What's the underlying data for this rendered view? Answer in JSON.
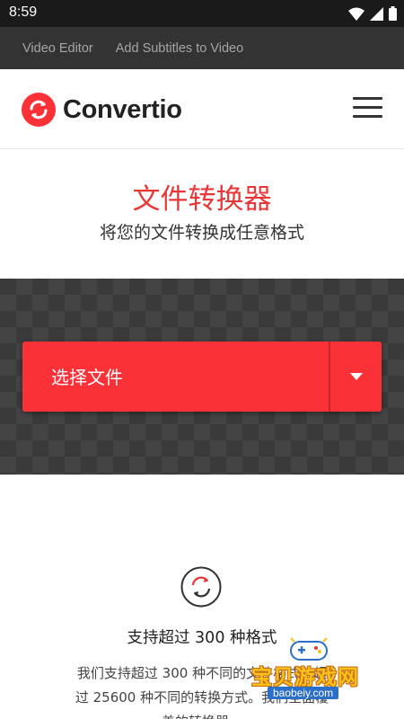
{
  "status_bar": {
    "time": "8:59"
  },
  "topnav": {
    "links": [
      "Video Editor",
      "Add Subtitles to Video"
    ]
  },
  "header": {
    "logo_text": "Convertio"
  },
  "hero": {
    "title": "文件转换器",
    "subtitle": "将您的文件转换成任意格式"
  },
  "upload": {
    "choose_label": "选择文件"
  },
  "features": {
    "title": "支持超过 300 种格式",
    "desc_line1": "我们支持超过 300 种不同的文件格式，超",
    "desc_line2": "过 25600 种不同的转换方式。我们全面覆",
    "desc_line3": "盖的转换器。"
  },
  "watermark": {
    "title": "宝贝游戏网",
    "url": "baobeiy.com"
  },
  "colors": {
    "brand_red": "#fb3138",
    "title_red": "#e93737",
    "topnav_bg": "#333333",
    "status_bg": "#1a1a1a"
  },
  "icons": [
    "wifi-icon",
    "signal-icon",
    "battery-icon",
    "convertio-logo-icon",
    "hamburger-menu-icon",
    "caret-down-icon",
    "convert-cycle-icon"
  ]
}
